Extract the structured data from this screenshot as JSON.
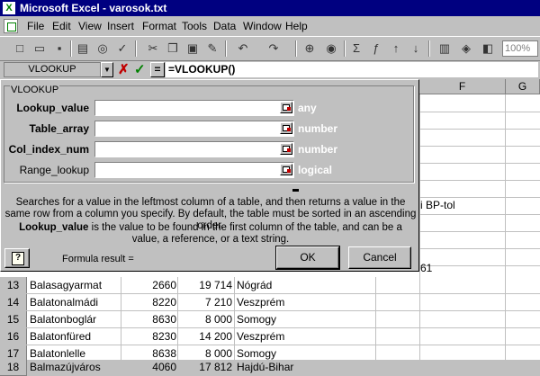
{
  "window": {
    "title": "Microsoft Excel - varosok.txt",
    "app_icon": "excel-icon"
  },
  "menu": [
    "File",
    "Edit",
    "View",
    "Insert",
    "Format",
    "Tools",
    "Data",
    "Window",
    "Help"
  ],
  "toolbar": {
    "zoom": "100%"
  },
  "formula_bar": {
    "name_box": "VLOOKUP",
    "cancel": "✗",
    "enter": "✓",
    "equals": "=",
    "formula": "=VLOOKUP()"
  },
  "sheet": {
    "columns": [
      "F",
      "G"
    ],
    "partial_cells": [
      "i BP-tol",
      "61"
    ],
    "rows": [
      {
        "num": "13",
        "city": "Balasagyarmat",
        "zip": "2660",
        "pop": "19 714",
        "county": "Nógrád"
      },
      {
        "num": "14",
        "city": "Balatonalmádi",
        "zip": "8220",
        "pop": "7 210",
        "county": "Veszprém"
      },
      {
        "num": "15",
        "city": "Balatonboglár",
        "zip": "8630",
        "pop": "8 000",
        "county": "Somogy"
      },
      {
        "num": "16",
        "city": "Balatonfüred",
        "zip": "8230",
        "pop": "14 200",
        "county": "Veszprém"
      },
      {
        "num": "17",
        "city": "Balatonlelle",
        "zip": "8638",
        "pop": "8 000",
        "county": "Somogy"
      },
      {
        "num": "18",
        "city": "Balmazújváros",
        "zip": "4060",
        "pop": "17 812",
        "county": "Hajdú-Bihar"
      }
    ]
  },
  "dialog": {
    "group_title": "VLOOKUP",
    "args": [
      {
        "label": "Lookup_value",
        "type": "any",
        "bold": true
      },
      {
        "label": "Table_array",
        "type": "number",
        "bold": true
      },
      {
        "label": "Col_index_num",
        "type": "number",
        "bold": true
      },
      {
        "label": "Range_lookup",
        "type": "logical",
        "bold": false
      }
    ],
    "description": "Searches for a value in the leftmost column of a table, and then returns a value in the same row from a column you specify. By default, the table must be sorted in an ascending order.",
    "arg_help_name": "Lookup_value",
    "arg_help_text": " is the value to be found in the first column of the table, and can be a value, a reference, or a text string.",
    "formula_result_label": "Formula result =",
    "help_glyph": "?",
    "ok": "OK",
    "cancel": "Cancel"
  }
}
